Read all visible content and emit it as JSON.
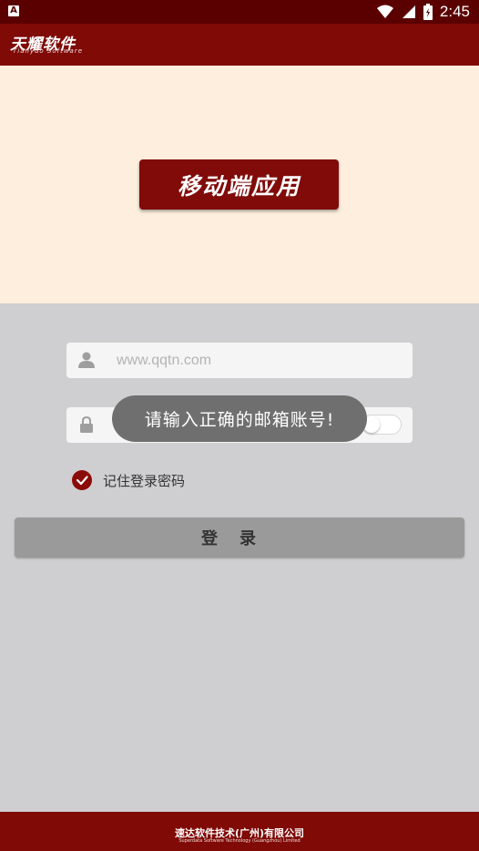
{
  "status_bar": {
    "notification_letter": "A",
    "time": "2:45"
  },
  "app_bar": {
    "brand_title": "天耀软件",
    "brand_subtitle": "Tianyao Software"
  },
  "hero": {
    "button_label": "移动端应用"
  },
  "form": {
    "username_placeholder": "www.qqtn.com",
    "username_value": "",
    "password_value": "",
    "password_visible_toggle": "off",
    "remember_label": "记住登录密码",
    "remember_checked": true,
    "login_label": "登录"
  },
  "toast": {
    "message": "请输入正确的邮箱账号!"
  },
  "footer": {
    "company_cn": "速达软件技术(广州)有限公司",
    "company_en": "Superdata Software Technology (Guangzhou) Limited"
  },
  "colors": {
    "brand_red": "#7f0a06",
    "status_bar": "#5a0000",
    "hero_bg": "#fdeedd",
    "page_bg": "#cfcfd1",
    "login_button": "#9a9a9a"
  },
  "icons": [
    "notification-a-icon",
    "wifi-icon",
    "signal-icon",
    "battery-icon",
    "user-icon",
    "lock-icon",
    "check-icon",
    "toggle-switch"
  ]
}
